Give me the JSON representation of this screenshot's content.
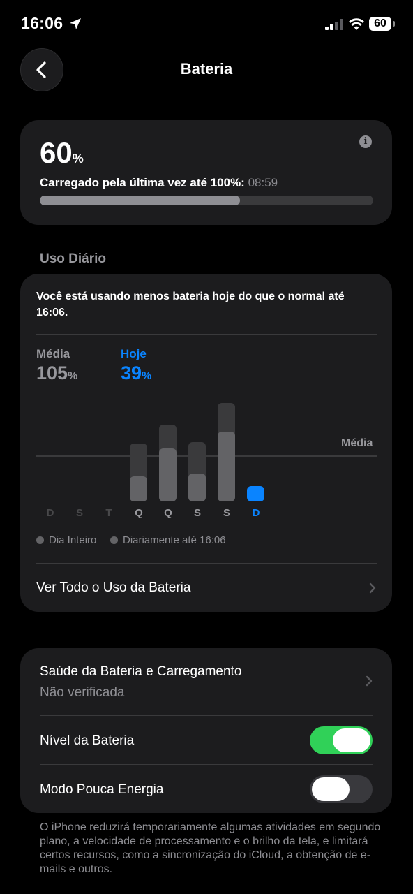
{
  "status_bar": {
    "time": "16:06",
    "battery_level": "60"
  },
  "header": {
    "title": "Bateria",
    "back_icon": "chevron-left-icon"
  },
  "battery_card": {
    "percent": "60",
    "percent_unit": "%",
    "charged_label": "Carregado pela última vez até 100%:",
    "charged_time": "08:59",
    "charge_fraction": 0.6,
    "info_icon": "info-icon"
  },
  "daily_usage": {
    "section_label": "Uso Diário",
    "message": "Você está usando menos bateria hoje do que o normal até 16:06.",
    "average_label": "Média",
    "average_value": "105",
    "today_label": "Hoje",
    "today_value": "39",
    "unit": "%",
    "avg_line_label": "Média",
    "days": [
      "D",
      "S",
      "T",
      "Q",
      "Q",
      "S",
      "S",
      "D"
    ],
    "legend": [
      {
        "label": "Dia Inteiro"
      },
      {
        "label": "Diariamente até 16:06"
      }
    ],
    "see_all": "Ver Todo o Uso da Bateria"
  },
  "chart_data": {
    "type": "bar",
    "categories": [
      "D",
      "S",
      "T",
      "Q",
      "Q",
      "S",
      "S",
      "D"
    ],
    "series": [
      {
        "name": "Dia Inteiro",
        "values": [
          null,
          null,
          null,
          84,
          112,
          86,
          143,
          null
        ]
      },
      {
        "name": "Diariamente até 16:06",
        "values": [
          null,
          null,
          null,
          37,
          77,
          41,
          101,
          22
        ]
      }
    ],
    "average_line_fraction_of_max": 0.54,
    "highlight_index": 7,
    "ylim": [
      0,
      145
    ],
    "grid": false
  },
  "settings": {
    "health_title": "Saúde da Bateria e Carregamento",
    "health_status": "Não verificada",
    "battery_level_label": "Nível da Bateria",
    "battery_level_on": true,
    "low_power_label": "Modo Pouca Energia",
    "low_power_on": false,
    "footnote": "O iPhone reduzirá temporariamente algumas atividades em segundo plano, a velocidade de processamento e o brilho da tela, e limitará certos recursos, como a sincronização do iCloud, a obtenção de e-mails e outros."
  },
  "colors": {
    "accent": "#0a84ff",
    "toggle_on": "#30d158",
    "card_bg": "#1c1c1e"
  }
}
